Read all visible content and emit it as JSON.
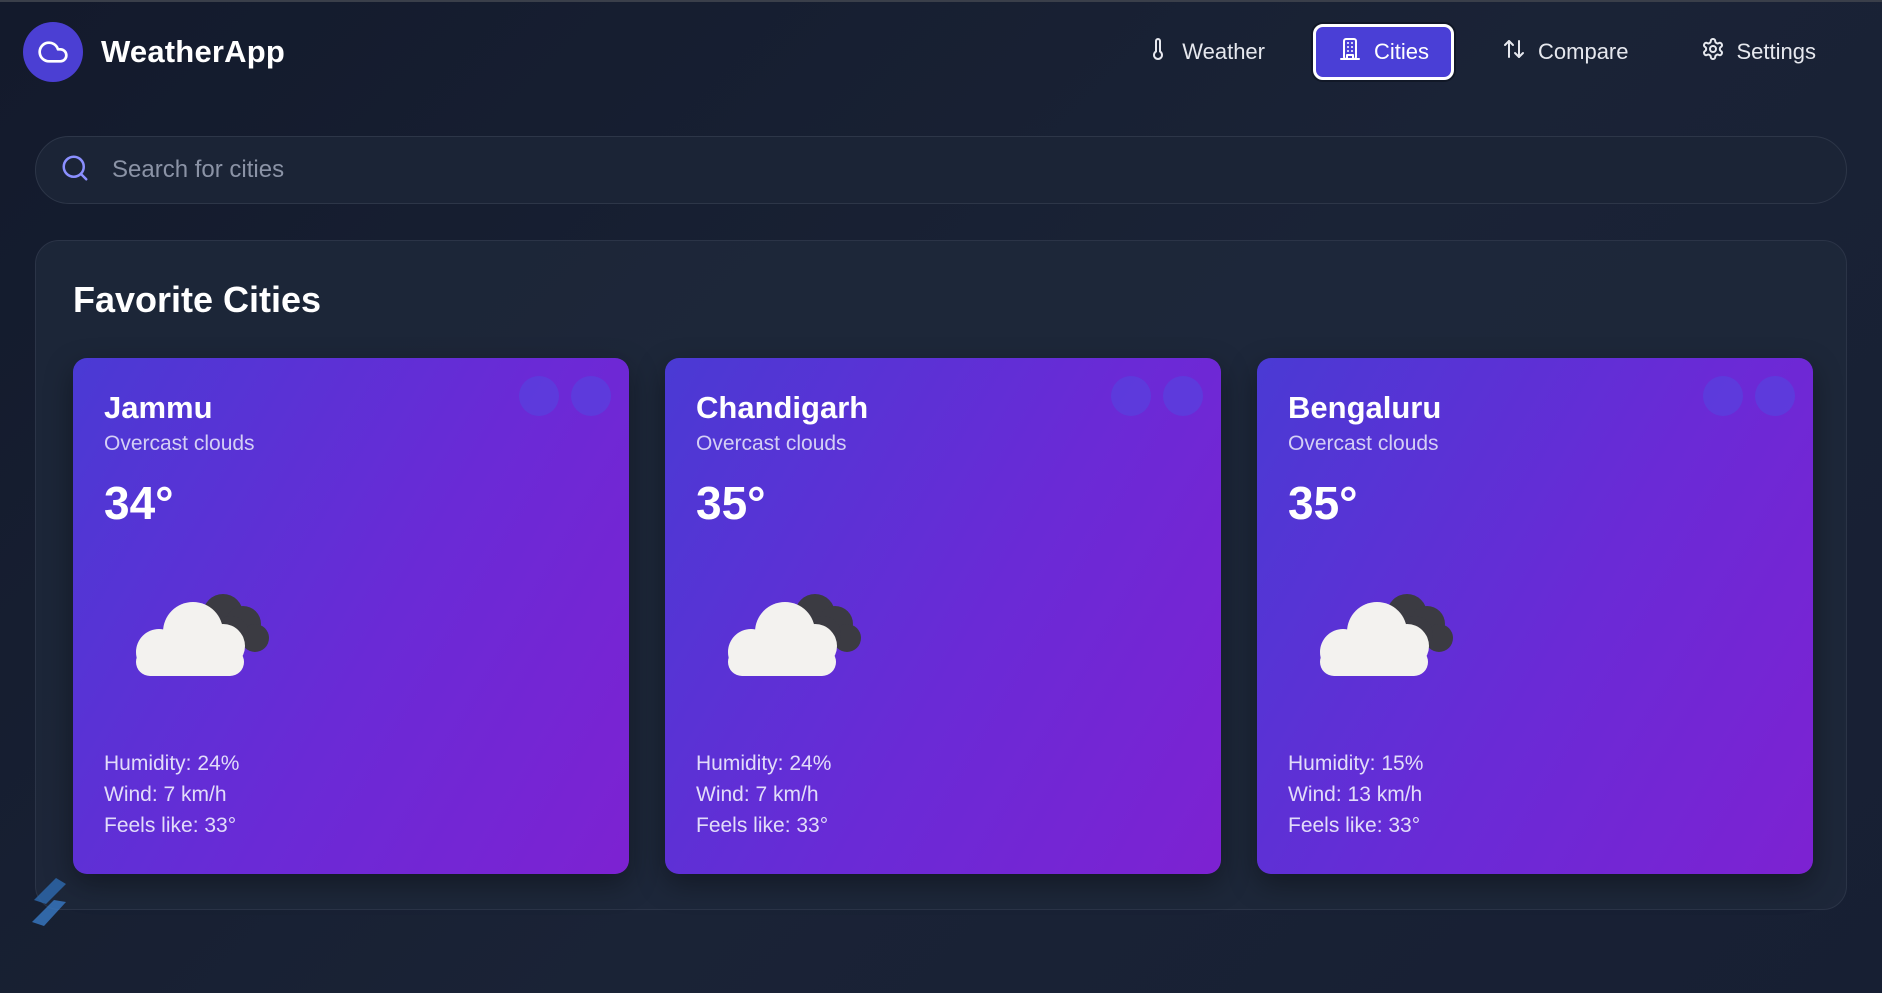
{
  "app": {
    "name": "WeatherApp"
  },
  "nav": {
    "items": [
      {
        "label": "Weather",
        "icon": "thermometer-icon",
        "active": false
      },
      {
        "label": "Cities",
        "icon": "building-icon",
        "active": true
      },
      {
        "label": "Compare",
        "icon": "arrows-up-down-icon",
        "active": false
      },
      {
        "label": "Settings",
        "icon": "gear-icon",
        "active": false
      }
    ]
  },
  "search": {
    "placeholder": "Search for cities",
    "value": ""
  },
  "favorites": {
    "title": "Favorite Cities",
    "cities": [
      {
        "name": "Jammu",
        "condition": "Overcast clouds",
        "temperature": "34°",
        "humidity": "Humidity: 24%",
        "wind": "Wind: 7 km/h",
        "feels_like": "Feels like: 33°"
      },
      {
        "name": "Chandigarh",
        "condition": "Overcast clouds",
        "temperature": "35°",
        "humidity": "Humidity: 24%",
        "wind": "Wind: 7 km/h",
        "feels_like": "Feels like: 33°"
      },
      {
        "name": "Bengaluru",
        "condition": "Overcast clouds",
        "temperature": "35°",
        "humidity": "Humidity: 15%",
        "wind": "Wind: 13 km/h",
        "feels_like": "Feels like: 33°"
      }
    ]
  },
  "colors": {
    "accent": "#4a3fd6",
    "card_gradient_start": "#4a3ad4",
    "card_gradient_end": "#7d22d2",
    "background": "#141b2d"
  }
}
